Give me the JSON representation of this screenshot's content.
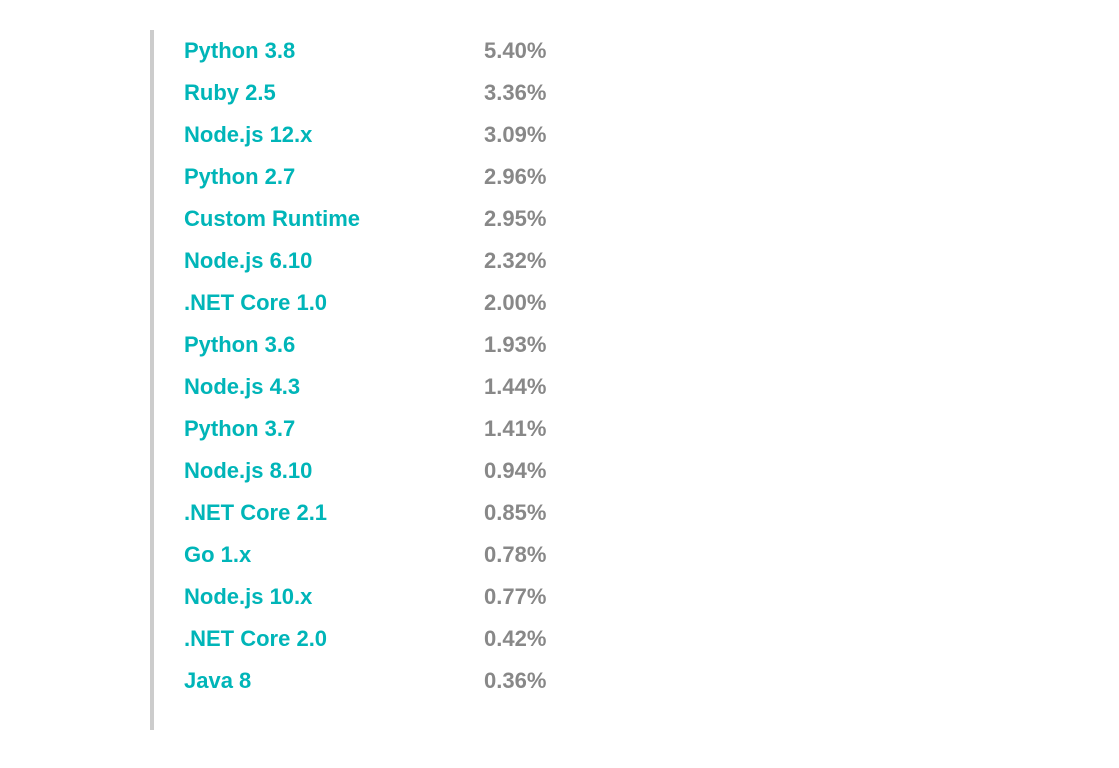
{
  "runtimes": [
    {
      "name": "Python 3.8",
      "value": "5.40%"
    },
    {
      "name": "Ruby 2.5",
      "value": "3.36%"
    },
    {
      "name": "Node.js 12.x",
      "value": "3.09%"
    },
    {
      "name": "Python 2.7",
      "value": "2.96%"
    },
    {
      "name": "Custom Runtime",
      "value": "2.95%"
    },
    {
      "name": "Node.js 6.10",
      "value": "2.32%"
    },
    {
      "name": ".NET Core 1.0",
      "value": "2.00%"
    },
    {
      "name": "Python 3.6",
      "value": "1.93%"
    },
    {
      "name": "Node.js 4.3",
      "value": "1.44%"
    },
    {
      "name": "Python 3.7",
      "value": "1.41%"
    },
    {
      "name": "Node.js 8.10",
      "value": "0.94%"
    },
    {
      "name": ".NET Core 2.1",
      "value": "0.85%"
    },
    {
      "name": "Go 1.x",
      "value": "0.78%"
    },
    {
      "name": "Node.js 10.x",
      "value": "0.77%"
    },
    {
      "name": ".NET Core 2.0",
      "value": "0.42%"
    },
    {
      "name": "Java 8",
      "value": "0.36%"
    }
  ]
}
